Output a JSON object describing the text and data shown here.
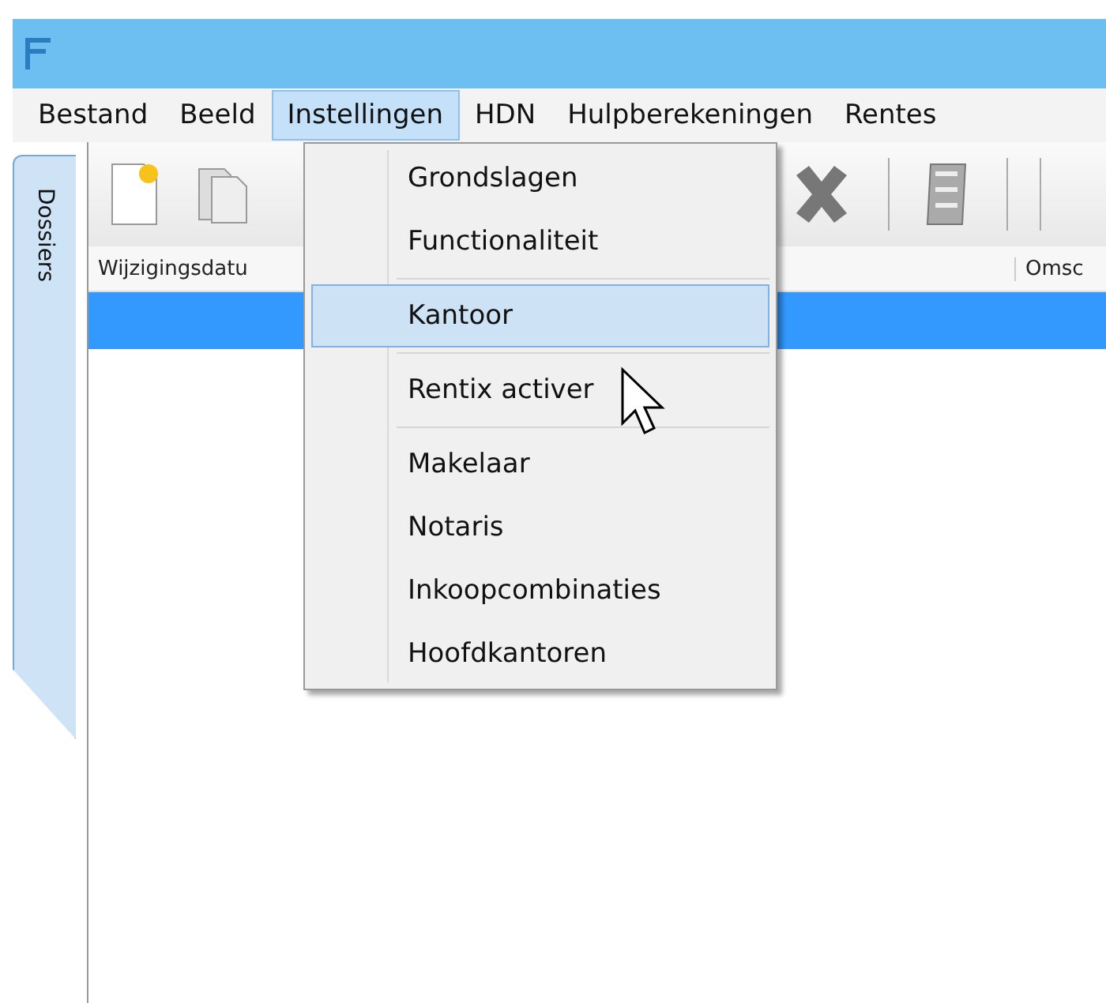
{
  "menubar": [
    {
      "label": "Bestand",
      "selected": false
    },
    {
      "label": "Beeld",
      "selected": false
    },
    {
      "label": "Instellingen",
      "selected": true
    },
    {
      "label": "HDN",
      "selected": false
    },
    {
      "label": "Hulpberekeningen",
      "selected": false
    },
    {
      "label": "Rentes",
      "selected": false
    }
  ],
  "side_tab": {
    "label": "Dossiers"
  },
  "table": {
    "columns": [
      "Wijzigingsdatu",
      "Omsc"
    ],
    "rows": [
      {
        "selected": true
      }
    ]
  },
  "dropdown": [
    {
      "kind": "item",
      "label": "Grondslagen",
      "selected": false
    },
    {
      "kind": "item",
      "label": "Functionaliteit",
      "selected": false
    },
    {
      "kind": "separator"
    },
    {
      "kind": "item",
      "label": "Kantoor",
      "selected": true
    },
    {
      "kind": "separator"
    },
    {
      "kind": "item",
      "label": "Rentix activer",
      "selected": false
    },
    {
      "kind": "separator"
    },
    {
      "kind": "item",
      "label": "Makelaar",
      "selected": false
    },
    {
      "kind": "item",
      "label": "Notaris",
      "selected": false
    },
    {
      "kind": "item",
      "label": "Inkoopcombinaties",
      "selected": false
    },
    {
      "kind": "item",
      "label": "Hoofdkantoren",
      "selected": false
    }
  ]
}
